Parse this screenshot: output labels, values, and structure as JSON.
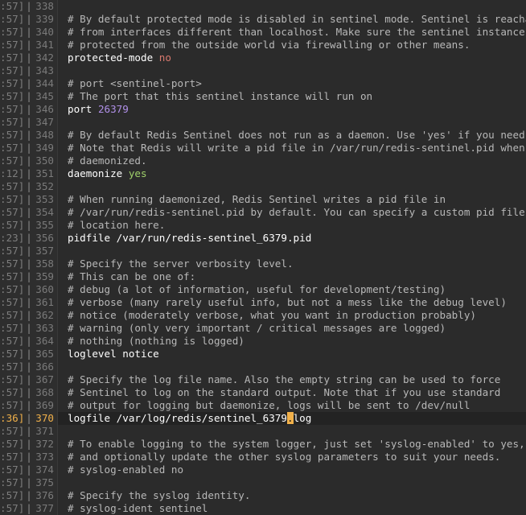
{
  "editor": {
    "lines": [
      {
        "tp": ":57]",
        "n": "338",
        "text": "",
        "type": "blank"
      },
      {
        "tp": ":57]",
        "n": "339",
        "text": "# By default protected mode is disabled in sentinel mode. Sentinel is reachable",
        "type": "comment"
      },
      {
        "tp": ":57]",
        "n": "340",
        "text": "# from interfaces different than localhost. Make sure the sentinel instance is",
        "type": "comment"
      },
      {
        "tp": ":57]",
        "n": "341",
        "text": "# protected from the outside world via firewalling or other means.",
        "type": "comment"
      },
      {
        "tp": ":57]",
        "n": "342",
        "key": "protected-mode",
        "val": "no",
        "valtype": "no",
        "type": "kv"
      },
      {
        "tp": ":57]",
        "n": "343",
        "text": "",
        "type": "blank"
      },
      {
        "tp": ":57]",
        "n": "344",
        "text": "# port <sentinel-port>",
        "type": "comment"
      },
      {
        "tp": ":57]",
        "n": "345",
        "text": "# The port that this sentinel instance will run on",
        "type": "comment"
      },
      {
        "tp": ":57]",
        "n": "346",
        "key": "port",
        "val": "26379",
        "valtype": "num",
        "type": "kv"
      },
      {
        "tp": ":57]",
        "n": "347",
        "text": "",
        "type": "blank"
      },
      {
        "tp": ":57]",
        "n": "348",
        "text": "# By default Redis Sentinel does not run as a daemon. Use 'yes' if you need it.",
        "type": "comment"
      },
      {
        "tp": ":57]",
        "n": "349",
        "text": "# Note that Redis will write a pid file in /var/run/redis-sentinel.pid when",
        "type": "comment"
      },
      {
        "tp": ":57]",
        "n": "350",
        "text": "# daemonized.",
        "type": "comment"
      },
      {
        "tp": ":12]",
        "n": "351",
        "key": "daemonize",
        "val": "yes",
        "valtype": "yes",
        "type": "kv"
      },
      {
        "tp": ":57]",
        "n": "352",
        "text": "",
        "type": "blank"
      },
      {
        "tp": ":57]",
        "n": "353",
        "text": "# When running daemonized, Redis Sentinel writes a pid file in",
        "type": "comment"
      },
      {
        "tp": ":57]",
        "n": "354",
        "text": "# /var/run/redis-sentinel.pid by default. You can specify a custom pid file",
        "type": "comment"
      },
      {
        "tp": ":57]",
        "n": "355",
        "text": "# location here.",
        "type": "comment"
      },
      {
        "tp": ":23]",
        "n": "356",
        "text": "pidfile /var/run/redis-sentinel_6379.pid",
        "type": "plain"
      },
      {
        "tp": ":57]",
        "n": "357",
        "text": "",
        "type": "blank"
      },
      {
        "tp": ":57]",
        "n": "358",
        "text": "# Specify the server verbosity level.",
        "type": "comment"
      },
      {
        "tp": ":57]",
        "n": "359",
        "text": "# This can be one of:",
        "type": "comment"
      },
      {
        "tp": ":57]",
        "n": "360",
        "text": "# debug (a lot of information, useful for development/testing)",
        "type": "comment"
      },
      {
        "tp": ":57]",
        "n": "361",
        "text": "# verbose (many rarely useful info, but not a mess like the debug level)",
        "type": "comment"
      },
      {
        "tp": ":57]",
        "n": "362",
        "text": "# notice (moderately verbose, what you want in production probably)",
        "type": "comment"
      },
      {
        "tp": ":57]",
        "n": "363",
        "text": "# warning (only very important / critical messages are logged)",
        "type": "comment"
      },
      {
        "tp": ":57]",
        "n": "364",
        "text": "# nothing (nothing is logged)",
        "type": "comment"
      },
      {
        "tp": ":57]",
        "n": "365",
        "text": "loglevel notice",
        "type": "plain"
      },
      {
        "tp": ":57]",
        "n": "366",
        "text": "",
        "type": "blank"
      },
      {
        "tp": ":57]",
        "n": "367",
        "text": "# Specify the log file name. Also the empty string can be used to force",
        "type": "comment"
      },
      {
        "tp": ":57]",
        "n": "368",
        "text": "# Sentinel to log on the standard output. Note that if you use standard",
        "type": "comment"
      },
      {
        "tp": ":57]",
        "n": "369",
        "text": "# output for logging but daemonize, logs will be sent to /dev/null",
        "type": "comment"
      },
      {
        "tp": ":36]",
        "n": "370",
        "pre": "logfile /var/log/redis/sentinel_6379",
        "cur": ".",
        "post": "log",
        "type": "current"
      },
      {
        "tp": ":57]",
        "n": "371",
        "text": "",
        "type": "blank"
      },
      {
        "tp": ":57]",
        "n": "372",
        "text": "# To enable logging to the system logger, just set 'syslog-enabled' to yes,",
        "type": "comment"
      },
      {
        "tp": ":57]",
        "n": "373",
        "text": "# and optionally update the other syslog parameters to suit your needs.",
        "type": "comment"
      },
      {
        "tp": ":57]",
        "n": "374",
        "text": "# syslog-enabled no",
        "type": "comment"
      },
      {
        "tp": ":57]",
        "n": "375",
        "text": "",
        "type": "blank"
      },
      {
        "tp": ":57]",
        "n": "376",
        "text": "# Specify the syslog identity.",
        "type": "comment"
      },
      {
        "tp": ":57]",
        "n": "377",
        "text": "# syslog-ident sentinel",
        "type": "comment"
      }
    ]
  }
}
